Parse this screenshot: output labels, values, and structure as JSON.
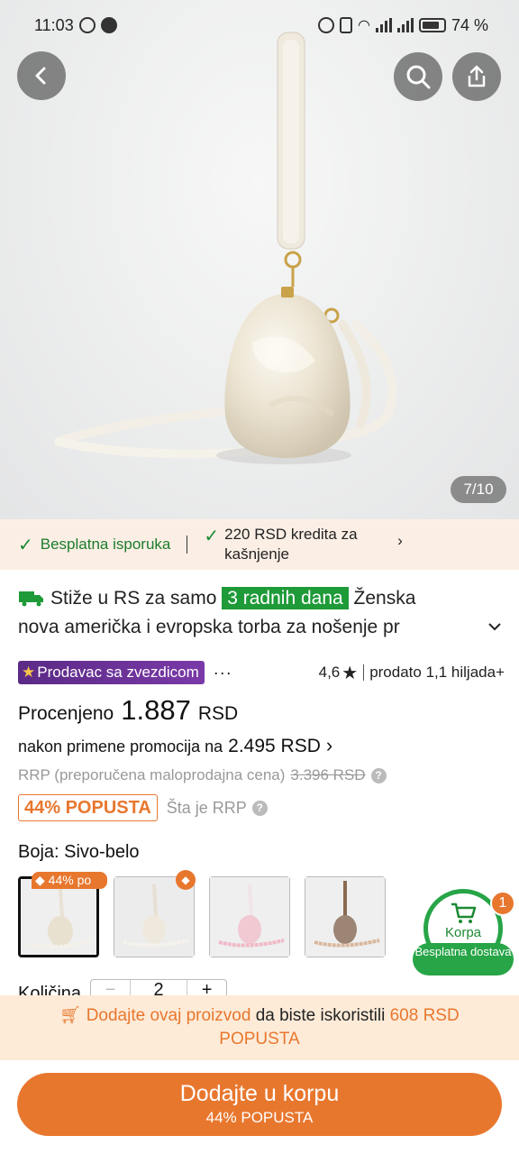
{
  "status_bar": {
    "time": "11:03",
    "battery": "74 %"
  },
  "gallery": {
    "counter": "7/10"
  },
  "benefits": [
    {
      "text": "Besplatna isporuka"
    },
    {
      "text": "220 RSD kredita za kašnjenje"
    }
  ],
  "product": {
    "delivery_prefix": "Stiže u RS za samo",
    "delivery_days": "3 radnih dana",
    "title_part1": "Ženska",
    "title_part2": "nova američka i evropska torba za nošenje pr",
    "seller_badge": "Prodavac sa zvezdicom",
    "more": "···",
    "rating": "4,6",
    "sold": "prodato 1,1 hiljada+",
    "price_label": "Procenjeno",
    "price_value": "1.887",
    "price_currency": "RSD",
    "promo_text": "nakon primene promocija na",
    "promo_value": "2.495 RSD",
    "rrp_label": "RRP (preporučena maloprodajna cena)",
    "rrp_value": "3.396 RSD",
    "discount_badge": "44% POPUSTA",
    "what_is_rrp": "Šta je RRP"
  },
  "color": {
    "label": "Boja: Sivo-belo",
    "swatches": [
      {
        "tag": "44% po",
        "selected": true
      },
      {
        "tag": "",
        "selected": false
      },
      {
        "tag": "",
        "selected": false
      },
      {
        "tag": "",
        "selected": false
      }
    ]
  },
  "quantity": {
    "label": "Količina",
    "value": "2",
    "minus": "−",
    "plus": "+"
  },
  "cart": {
    "label": "Korpa",
    "count": "1",
    "shipping": "Besplatna dostava"
  },
  "promo_banner": {
    "link": "Dodajte ovaj proizvod",
    "middle": "da biste iskoristili",
    "amount": "608 RSD POPUSTA"
  },
  "add_button": {
    "label": "Dodajte u korpu",
    "sub": "44% POPUSTA"
  },
  "colors": {
    "accent": "#e8772e",
    "green": "#1e9a38",
    "purple": "#6a2f97"
  }
}
